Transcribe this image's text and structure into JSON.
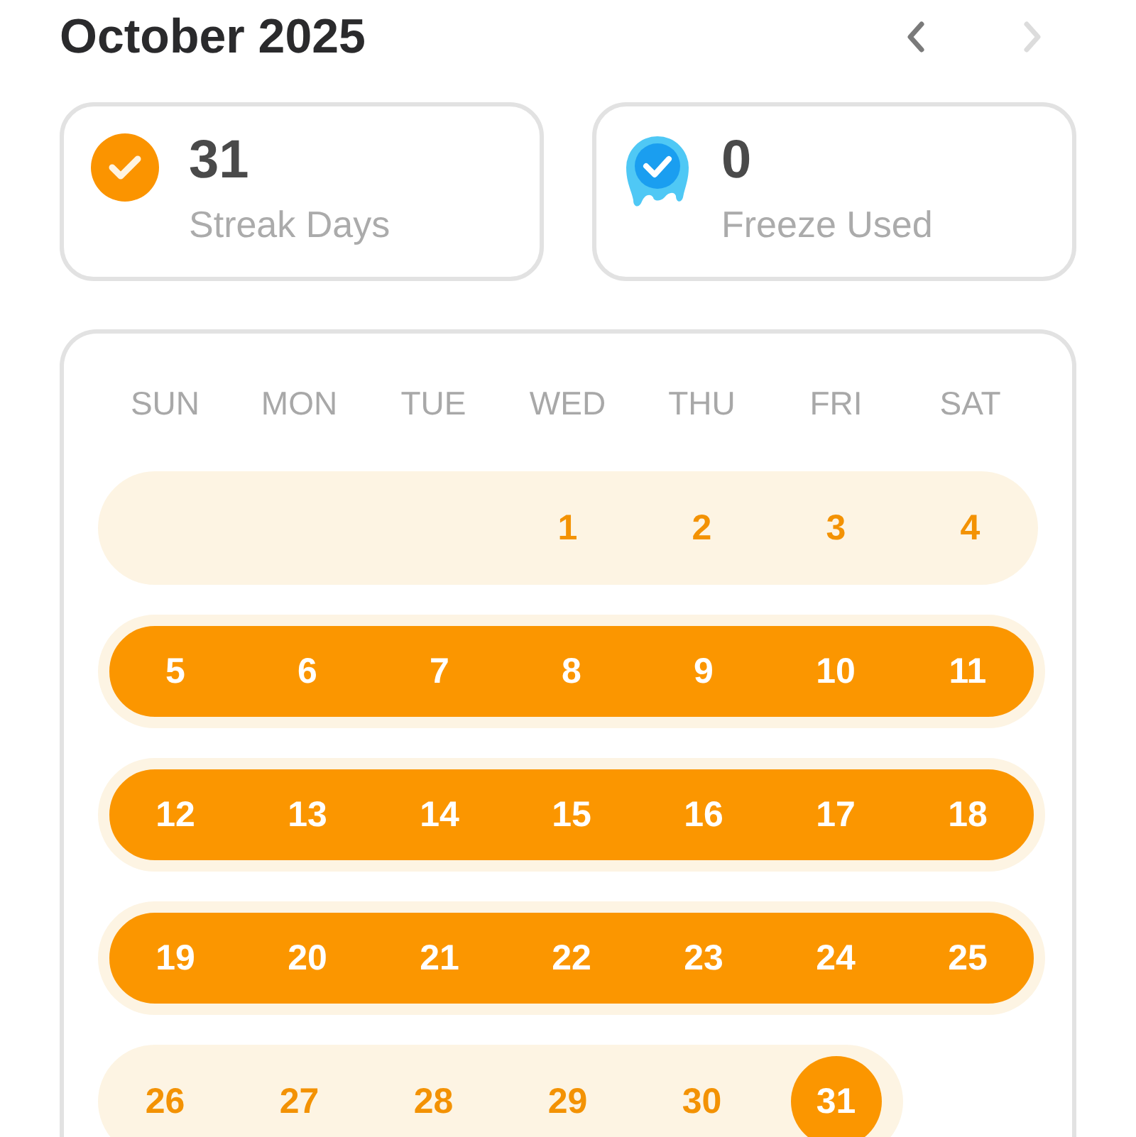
{
  "header": {
    "title": "October 2025",
    "nav": [
      {
        "kind": "prev",
        "disabled": false
      },
      {
        "kind": "next",
        "disabled": true
      }
    ]
  },
  "stats": [
    {
      "kind": "streak",
      "value": "31",
      "label": "Streak Days"
    },
    {
      "kind": "freeze",
      "value": "0",
      "label": "Freeze Used"
    }
  ],
  "calendar": {
    "weekdays": [
      "SUN",
      "MON",
      "TUE",
      "WED",
      "THU",
      "FRI",
      "SAT"
    ],
    "weeks": [
      {
        "streak": false,
        "days": [
          {
            "empty": true
          },
          {
            "empty": true
          },
          {
            "empty": true
          },
          {
            "label": "1",
            "today": false
          },
          {
            "label": "2",
            "today": false
          },
          {
            "label": "3",
            "today": false
          },
          {
            "label": "4",
            "today": false
          }
        ]
      },
      {
        "streak": true,
        "days": [
          {
            "label": "5",
            "today": false
          },
          {
            "label": "6",
            "today": false
          },
          {
            "label": "7",
            "today": false
          },
          {
            "label": "8",
            "today": false
          },
          {
            "label": "9",
            "today": false
          },
          {
            "label": "10",
            "today": false
          },
          {
            "label": "11",
            "today": false
          }
        ]
      },
      {
        "streak": true,
        "days": [
          {
            "label": "12",
            "today": false
          },
          {
            "label": "13",
            "today": false
          },
          {
            "label": "14",
            "today": false
          },
          {
            "label": "15",
            "today": false
          },
          {
            "label": "16",
            "today": false
          },
          {
            "label": "17",
            "today": false
          },
          {
            "label": "18",
            "today": false
          }
        ]
      },
      {
        "streak": true,
        "days": [
          {
            "label": "19",
            "today": false
          },
          {
            "label": "20",
            "today": false
          },
          {
            "label": "21",
            "today": false
          },
          {
            "label": "22",
            "today": false
          },
          {
            "label": "23",
            "today": false
          },
          {
            "label": "24",
            "today": false
          },
          {
            "label": "25",
            "today": false
          }
        ]
      },
      {
        "streak": false,
        "days": [
          {
            "label": "26",
            "today": false
          },
          {
            "label": "27",
            "today": false
          },
          {
            "label": "28",
            "today": false
          },
          {
            "label": "29",
            "today": false
          },
          {
            "label": "30",
            "today": false
          },
          {
            "label": "31",
            "today": true
          }
        ]
      }
    ]
  }
}
